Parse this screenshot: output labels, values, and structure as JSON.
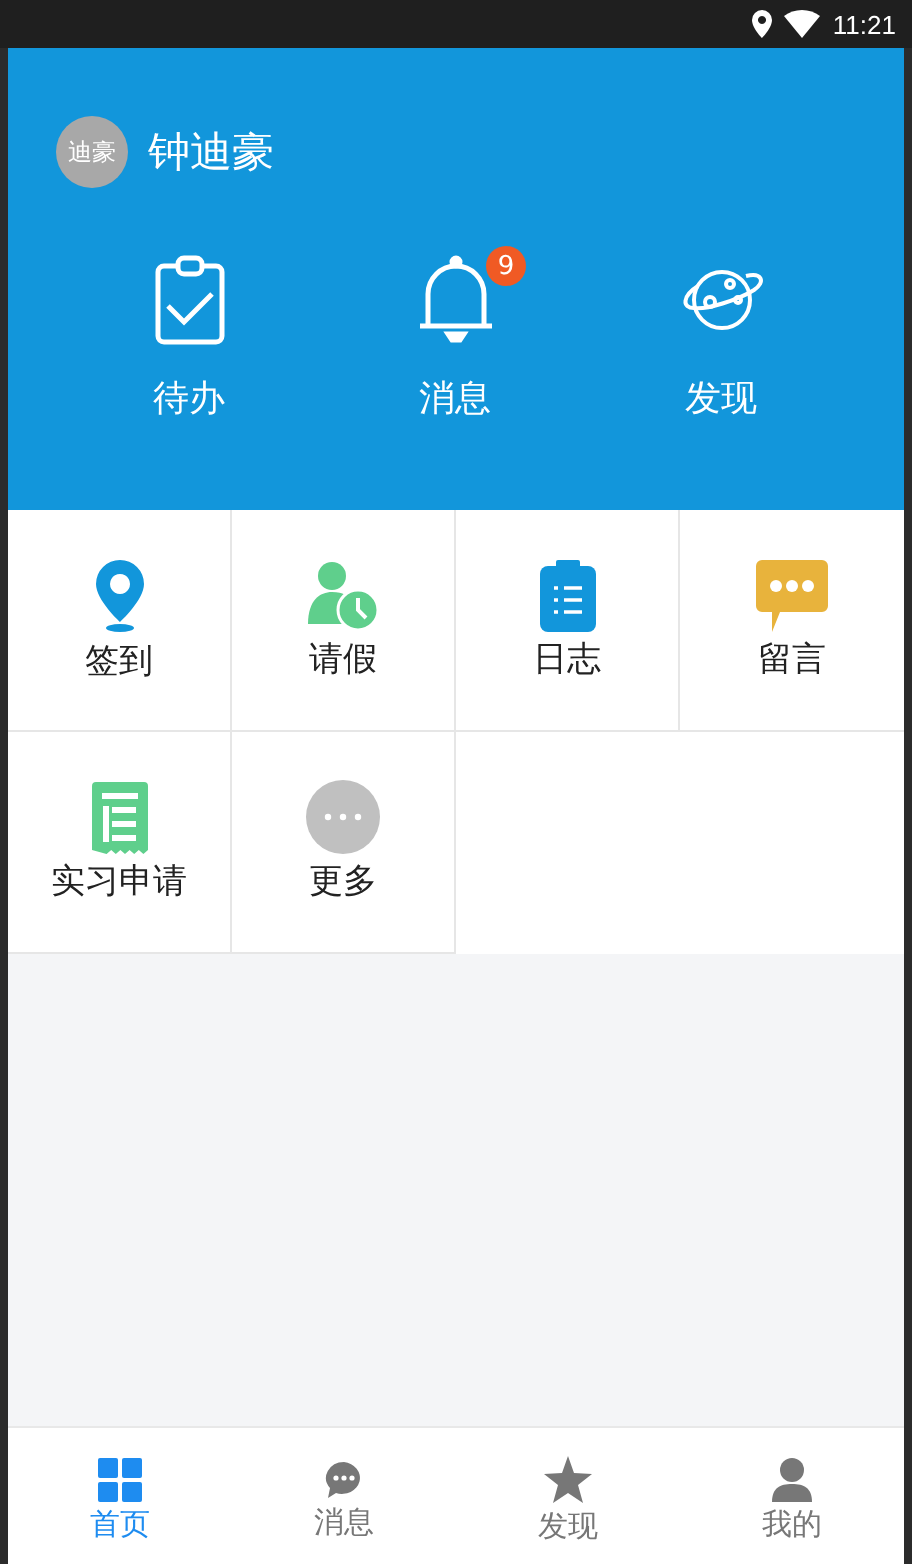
{
  "status_bar": {
    "time": "11:21"
  },
  "user": {
    "avatar_text": "迪豪",
    "name": "钟迪豪"
  },
  "shortcuts": [
    {
      "kind": "todo",
      "label": "待办"
    },
    {
      "kind": "bell",
      "label": "消息",
      "badge": "9"
    },
    {
      "kind": "planet",
      "label": "发现"
    }
  ],
  "apps": [
    {
      "kind": "location",
      "label": "签到"
    },
    {
      "kind": "leave",
      "label": "请假"
    },
    {
      "kind": "log",
      "label": "日志"
    },
    {
      "kind": "comment",
      "label": "留言"
    },
    {
      "kind": "apply",
      "label": "实习申请"
    },
    {
      "kind": "more",
      "label": "更多"
    }
  ],
  "tab_bar": [
    {
      "kind": "home",
      "label": "首页",
      "selected": true
    },
    {
      "kind": "chat",
      "label": "消息",
      "selected": false
    },
    {
      "kind": "star",
      "label": "发现",
      "selected": false
    },
    {
      "kind": "person",
      "label": "我的",
      "selected": false
    }
  ]
}
